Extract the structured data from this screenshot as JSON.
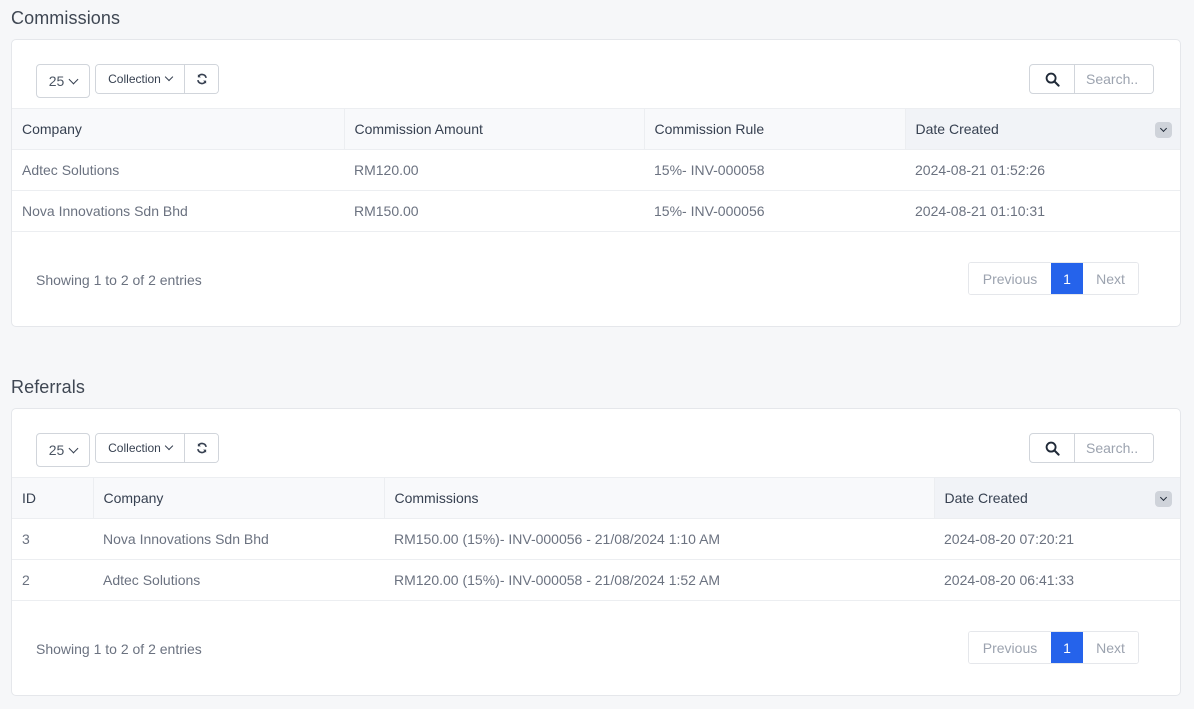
{
  "commissions": {
    "title": "Commissions",
    "toolbar": {
      "page_length": "25",
      "collection_label": "Collection",
      "refresh_icon": "refresh-icon",
      "search_icon": "search-icon",
      "search_placeholder": "Search..",
      "search_value": ""
    },
    "columns": [
      "Company",
      "Commission Amount",
      "Commission Rule",
      "Date Created"
    ],
    "sorted_column": "Date Created",
    "rows": [
      [
        "Adtec Solutions",
        "RM120.00",
        "15%- INV-000058",
        "2024-08-21 01:52:26"
      ],
      [
        "Nova Innovations Sdn Bhd",
        "RM150.00",
        "15%- INV-000056",
        "2024-08-21 01:10:31"
      ]
    ],
    "info": "Showing 1 to 2 of 2 entries",
    "pagination": {
      "previous": "Previous",
      "current": "1",
      "next": "Next"
    }
  },
  "referrals": {
    "title": "Referrals",
    "toolbar": {
      "page_length": "25",
      "collection_label": "Collection",
      "refresh_icon": "refresh-icon",
      "search_icon": "search-icon",
      "search_placeholder": "Search..",
      "search_value": ""
    },
    "columns": [
      "ID",
      "Company",
      "Commissions",
      "Date Created"
    ],
    "sorted_column": "Date Created",
    "rows": [
      [
        "3",
        "Nova Innovations Sdn Bhd",
        "RM150.00 (15%)- INV-000056 - 21/08/2024 1:10 AM",
        "2024-08-20 07:20:21"
      ],
      [
        "2",
        "Adtec Solutions",
        "RM120.00 (15%)- INV-000058 - 21/08/2024 1:52 AM",
        "2024-08-20 06:41:33"
      ]
    ],
    "info": "Showing 1 to 2 of 2 entries",
    "pagination": {
      "previous": "Previous",
      "current": "1",
      "next": "Next"
    }
  },
  "colors": {
    "accent": "#2563eb",
    "page_bg": "#f6f7f9",
    "card_bg": "#ffffff"
  }
}
